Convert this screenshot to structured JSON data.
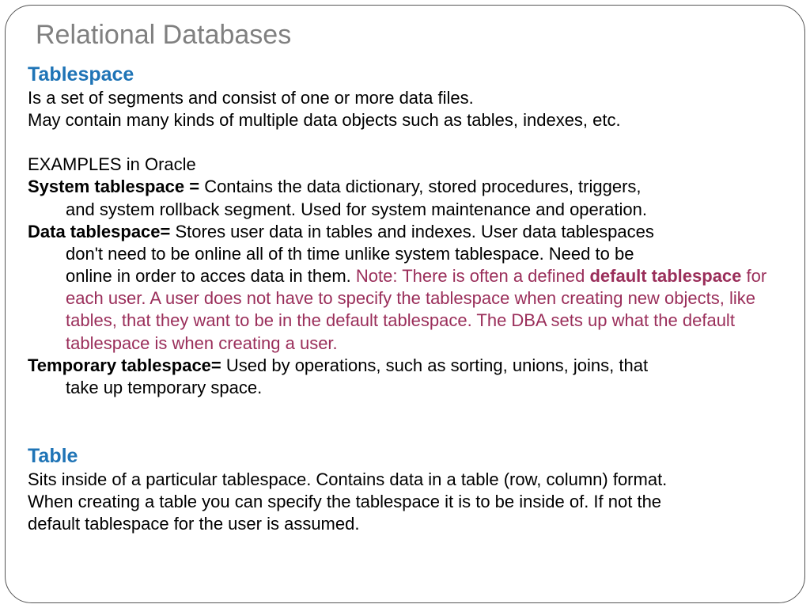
{
  "title": "Relational Databases",
  "sec1": {
    "heading": "Tablespace",
    "line1": "Is a set of segments and consist of one or more data files.",
    "line2": " May contain many kinds of multiple data objects such as tables, indexes, etc.",
    "examples": "EXAMPLES in Oracle",
    "sys_label": "System tablespace = ",
    "sys_text1": "Contains the data dictionary, stored procedures, triggers,",
    "sys_text2": "and system rollback segment.  Used for system maintenance and operation.",
    "data_label": "Data tablespace= ",
    "data_text1": "Stores user data in tables and indexes.  User data tablespaces",
    "data_text2": "don't need to be online all of th time unlike system tablespace.  Need to be",
    "data_text3a": "online in order to acces data in them. ",
    "note_a": "Note: There is often a defined ",
    "note_bold": "default tablespace ",
    "note_b": "for each user. A user does not have to specify the tablespace when creating new objects, like tables, that they want to be in the default tablespace. The DBA sets up what the default tablespace is when creating a user.",
    "temp_label": "Temporary tablespace= ",
    "temp_text1": "Used by operations, such as sorting, unions, joins, that",
    "temp_text2": " take up temporary space."
  },
  "sec2": {
    "heading": "Table",
    "line1": "Sits inside of a particular tablespace.  Contains data in a table (row, column) format.",
    "line2": " When creating a table you can specify the tablespace it is to be inside of. If not the",
    "line3": " default tablespace for the user is assumed."
  }
}
